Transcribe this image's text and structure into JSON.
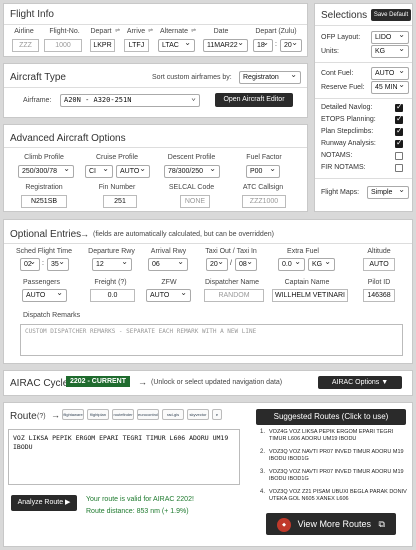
{
  "flight_info": {
    "title": "Flight Info",
    "labels": {
      "airline": "Airline",
      "flight_no": "Flight-No.",
      "depart": "Depart",
      "arrive": "Arrive",
      "alternate": "Alternate",
      "date": "Date",
      "depart_zulu": "Depart (Zulu)"
    },
    "airline_placeholder": "ZZZ",
    "flight_no_placeholder": "1000",
    "depart_value": "LKPR",
    "arrive_value": "LTFJ",
    "alternate_value": "LTAC",
    "date_value": "11MAR22",
    "depart_hour": "18",
    "depart_minute": "20",
    "time_sep": ":"
  },
  "selections": {
    "title": "Selections",
    "save_default": "Save Default",
    "ofp_layout_label": "OFP Layout:",
    "ofp_layout_value": "LIDO",
    "units_label": "Units:",
    "units_value": "KG",
    "cont_fuel_label": "Cont Fuel:",
    "cont_fuel_value": "AUTO",
    "reserve_fuel_label": "Reserve Fuel:",
    "reserve_fuel_value": "45 MIN",
    "checks": [
      {
        "label": "Detailed Navlog:",
        "checked": true
      },
      {
        "label": "ETOPS Planning:",
        "checked": true
      },
      {
        "label": "Plan Stepclimbs:",
        "checked": true
      },
      {
        "label": "Runway Analysis:",
        "checked": true
      },
      {
        "label": "NOTAMS:",
        "checked": false
      },
      {
        "label": "FIR NOTAMS:",
        "checked": false
      }
    ],
    "flight_maps_label": "Flight Maps:",
    "flight_maps_value": "Simple"
  },
  "aircraft": {
    "title": "Aircraft Type",
    "sort_label": "Sort custom airframes by:",
    "sort_value": "Registraton",
    "airframe_label": "Airframe:",
    "airframe_value": "A20N - A320-251N",
    "open_editor": "Open Aircraft Editor"
  },
  "advanced": {
    "title": "Advanced Aircraft Options",
    "climb_label": "Climb Profile",
    "climb_value": "250/300/78",
    "cruise_label": "Cruise Profile",
    "cruise_value": "CI",
    "cruise_value2": "AUTO",
    "descent_label": "Descent Profile",
    "descent_value": "78/300/250",
    "fuel_factor_label": "Fuel Factor",
    "fuel_factor_value": "P00",
    "registration_label": "Registration",
    "registration_value": "N251SB",
    "fin_label": "Fin Number",
    "fin_value": "251",
    "selcal_label": "SELCAL Code",
    "selcal_placeholder": "NONE",
    "atc_label": "ATC Callsign",
    "atc_placeholder": "ZZZ1000"
  },
  "optional": {
    "title": "Optional Entries",
    "note": "(fields are automatically calculated, but can be overridden)",
    "sched_label": "Sched Flight Time",
    "sched_h": "02",
    "sched_m": "35",
    "dep_rwy_label": "Departure Rwy",
    "dep_rwy_value": "12",
    "arr_rwy_label": "Arrival Rwy",
    "arr_rwy_value": "06",
    "taxi_label": "Taxi Out / Taxi In",
    "taxi_out": "20",
    "taxi_in": "08",
    "extra_fuel_label": "Extra Fuel",
    "extra_fuel_value": "0.0",
    "extra_fuel_unit": "KG",
    "altitude_label": "Altitude",
    "altitude_value": "AUTO",
    "passengers_label": "Passengers",
    "passengers_value": "AUTO",
    "freight_label": "Freight (?)",
    "freight_value": "0.0",
    "zfw_label": "ZFW",
    "zfw_value": "AUTO",
    "dispatcher_label": "Dispatcher Name",
    "dispatcher_placeholder": "RANDOM",
    "captain_label": "Captain Name",
    "captain_value": "WILLHELM VETINARI",
    "pilot_id_label": "Pilot ID",
    "pilot_id_value": "146368",
    "remarks_label": "Dispatch Remarks",
    "remarks_placeholder": "CUSTOM DISPATCHER REMARKS - SEPARATE EACH REMARK WITH A NEW LINE"
  },
  "airac": {
    "title": "AIRAC Cycle",
    "badge": "2202 - CURRENT",
    "note": "(Unlock or select updated navigation data)",
    "options": "AIRAC Options ▼"
  },
  "route": {
    "title": "Route",
    "help": "(?)",
    "source_logos": [
      "flightaware",
      "flightplan",
      "routefinder",
      "eurocontrol",
      "rad-gis",
      "skyvector",
      "e"
    ],
    "text": "VOZ LIKSA PEPIK ERGOM EPARI TEGRI TIMUR L606 ADORU UM19 IBODU",
    "analyze": "Analyze Route ▶",
    "valid_msg": "Your route is valid for AIRAC 2202!",
    "distance_msg": "Route distance: 853 nm (+ 1.9%)"
  },
  "suggested": {
    "title": "Suggested Routes (Click to use)",
    "items": [
      "VOZ4G VOZ LIKSA PEPIK ERGOM EPARI TEGRI TIMUR L606 ADORU UM19 IBODU",
      "VOZ3Q VOZ NAVTI PR07 INVED TIMUR ADORU M19 IBODU IBOD1G",
      "VOZ3Q VOZ NAVTI PR07 INVED TIMUR ADORU M19 IBODU IBOD1G",
      "VOZ3Q VOZ Z21 PISAM UBUXI BEGLA PARAK DONIV UTEKA GOL N605 XANEX L606"
    ],
    "more": "View More Routes"
  }
}
